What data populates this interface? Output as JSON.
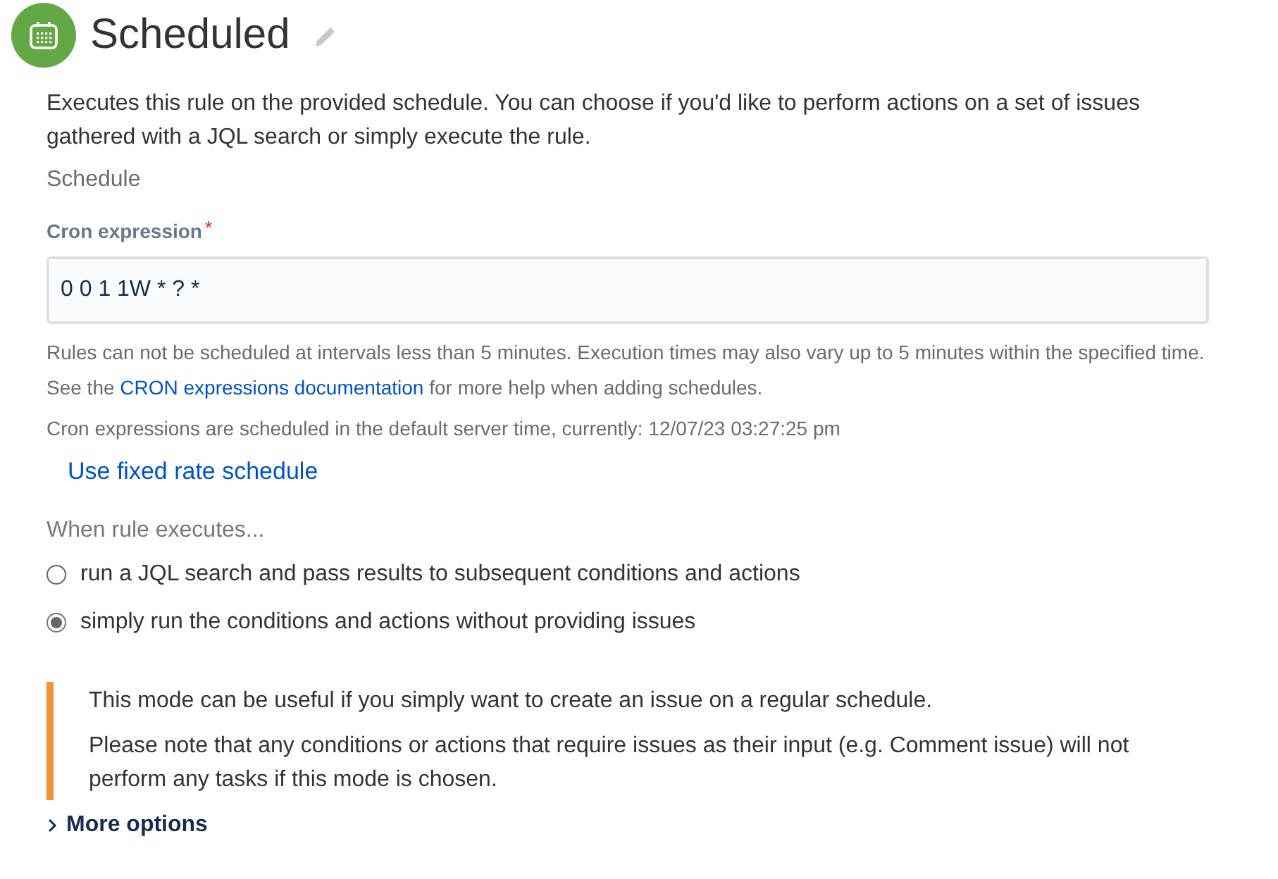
{
  "header": {
    "title": "Scheduled"
  },
  "description": "Executes this rule on the provided schedule. You can choose if you'd like to perform actions on a set of issues gathered with a JQL search or simply execute the rule.",
  "section_label": "Schedule",
  "cron": {
    "label": "Cron expression",
    "required_mark": "*",
    "value": "0 0 1 1W * ? *"
  },
  "help": {
    "before": "Rules can not be scheduled at intervals less than 5 minutes. Execution times may also vary up to 5 minutes within the specified time. See the ",
    "link": "CRON expressions documentation",
    "after": " for more help when adding schedules."
  },
  "server_time": "Cron expressions are scheduled in the default server time, currently: 12/07/23 03:27:25 pm",
  "fixed_rate_link": "Use fixed rate schedule",
  "execution": {
    "label": "When rule executes...",
    "options": [
      {
        "label": "run a JQL search and pass results to subsequent conditions and actions",
        "selected": false
      },
      {
        "label": "simply run the conditions and actions without providing issues",
        "selected": true
      }
    ]
  },
  "notice": [
    "This mode can be useful if you simply want to create an issue on a regular schedule.",
    "Please note that any conditions or actions that require issues as their input (e.g. Comment issue) will not perform any tasks if this mode is chosen."
  ],
  "more_options": {
    "label": "More options",
    "expanded": false
  }
}
